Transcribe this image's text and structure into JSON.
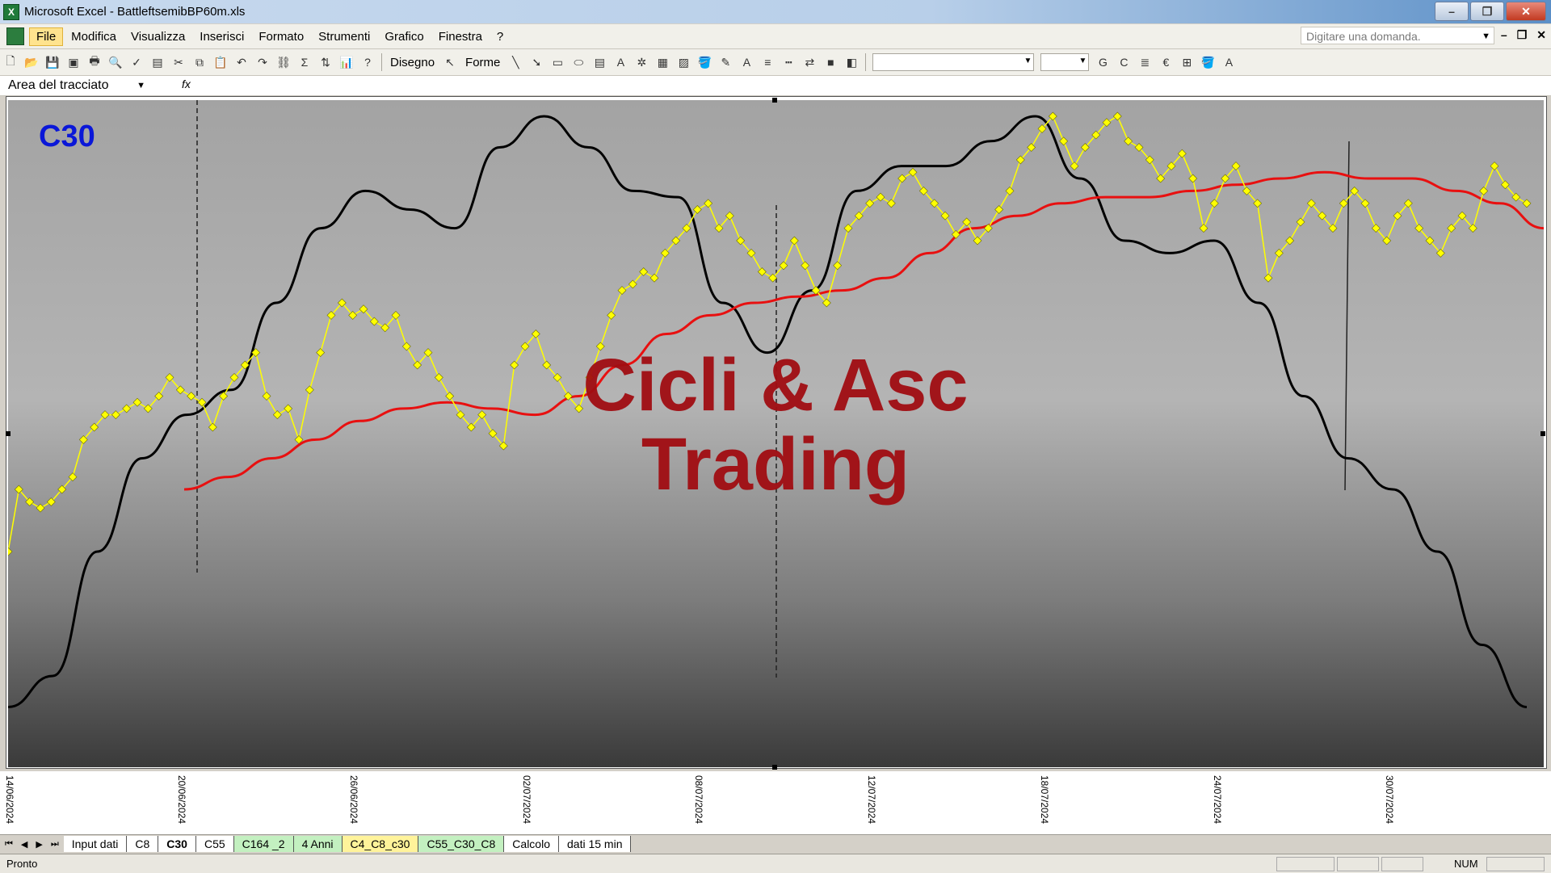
{
  "window": {
    "title": "Microsoft Excel - BattleftsemibBP60m.xls"
  },
  "menu": {
    "items": [
      "File",
      "Modifica",
      "Visualizza",
      "Inserisci",
      "Formato",
      "Strumenti",
      "Grafico",
      "Finestra",
      "?"
    ],
    "help_placeholder": "Digitare una domanda."
  },
  "toolbar": {
    "drawing_label": "Disegno",
    "shapes_label": "Forme"
  },
  "namebox": {
    "value": "Area del tracciato",
    "fx": "fx"
  },
  "chart": {
    "title_label": "C30",
    "watermark_line1": "Cicli & Asc",
    "watermark_line2": "Trading",
    "colors": {
      "price": "#ffff00",
      "ma": "#e81010",
      "cycle": "#000000",
      "title": "#0a17d8",
      "watermark": "#a10d12"
    },
    "x_labels": [
      "14/06/2024",
      "20/06/2024",
      "26/06/2024",
      "02/07/2024",
      "08/07/2024",
      "12/07/2024",
      "18/07/2024",
      "24/07/2024",
      "30/07/2024"
    ]
  },
  "chart_data": {
    "type": "line",
    "title": "C30",
    "x_tick_labels": [
      "14/06/2024",
      "20/06/2024",
      "26/06/2024",
      "02/07/2024",
      "08/07/2024",
      "12/07/2024",
      "18/07/2024",
      "24/07/2024",
      "30/07/2024"
    ],
    "series": [
      {
        "values": [
          0.3,
          0.4,
          0.38,
          0.37,
          0.38,
          0.4,
          0.42,
          0.48,
          0.5,
          0.52,
          0.52,
          0.53,
          0.54,
          0.53,
          0.55,
          0.58,
          0.56,
          0.55,
          0.54,
          0.5,
          0.55,
          0.58,
          0.6,
          0.62,
          0.55,
          0.52,
          0.53,
          0.48,
          0.56,
          0.62,
          0.68,
          0.7,
          0.68,
          0.69,
          0.67,
          0.66,
          0.68,
          0.63,
          0.6,
          0.62,
          0.58,
          0.55,
          0.52,
          0.5,
          0.52,
          0.49,
          0.47,
          0.6,
          0.63,
          0.65,
          0.6,
          0.58,
          0.55,
          0.53,
          0.58,
          0.63,
          0.68,
          0.72,
          0.73,
          0.75,
          0.74,
          0.78,
          0.8,
          0.82,
          0.85,
          0.86,
          0.82,
          0.84,
          0.8,
          0.78,
          0.75,
          0.74,
          0.76,
          0.8,
          0.76,
          0.72,
          0.7,
          0.76,
          0.82,
          0.84,
          0.86,
          0.87,
          0.86,
          0.9,
          0.91,
          0.88,
          0.86,
          0.84,
          0.81,
          0.83,
          0.8,
          0.82,
          0.85,
          0.88,
          0.93,
          0.95,
          0.98,
          1.0,
          0.96,
          0.92,
          0.95,
          0.97,
          0.99,
          1.0,
          0.96,
          0.95,
          0.93,
          0.9,
          0.92,
          0.94,
          0.9,
          0.82,
          0.86,
          0.9,
          0.92,
          0.88,
          0.86,
          0.74,
          0.78,
          0.8,
          0.83,
          0.86,
          0.84,
          0.82,
          0.86,
          0.88,
          0.86,
          0.82,
          0.8,
          0.84,
          0.86,
          0.82,
          0.8,
          0.78,
          0.82,
          0.84,
          0.82,
          0.88,
          0.92,
          0.89,
          0.87,
          0.86
        ]
      },
      {
        "values": [
          0.4,
          0.42,
          0.45,
          0.48,
          0.51,
          0.53,
          0.54,
          0.53,
          0.52,
          0.55,
          0.6,
          0.65,
          0.68,
          0.7,
          0.71,
          0.72,
          0.74,
          0.78,
          0.82,
          0.84,
          0.86,
          0.87,
          0.87,
          0.88,
          0.89,
          0.9,
          0.91,
          0.9,
          0.9,
          0.88,
          0.86,
          0.82
        ]
      },
      {
        "values": [
          0.05,
          0.1,
          0.3,
          0.45,
          0.52,
          0.56,
          0.7,
          0.82,
          0.88,
          0.85,
          0.82,
          0.95,
          1.0,
          0.95,
          0.88,
          0.87,
          0.7,
          0.62,
          0.72,
          0.88,
          0.92,
          0.92,
          0.96,
          1.0,
          0.9,
          0.8,
          0.78,
          0.8,
          0.7,
          0.55,
          0.45,
          0.4,
          0.3,
          0.15,
          0.05
        ]
      }
    ]
  },
  "sheets": {
    "tabs": [
      "Input dati",
      "C8",
      "C30",
      "C55",
      "C164 _2",
      "4 Anni",
      "C4_C8_c30",
      "C55_C30_C8",
      "Calcolo",
      "dati 15 min"
    ],
    "active": "C30"
  },
  "status": {
    "ready": "Pronto",
    "num": "NUM"
  }
}
